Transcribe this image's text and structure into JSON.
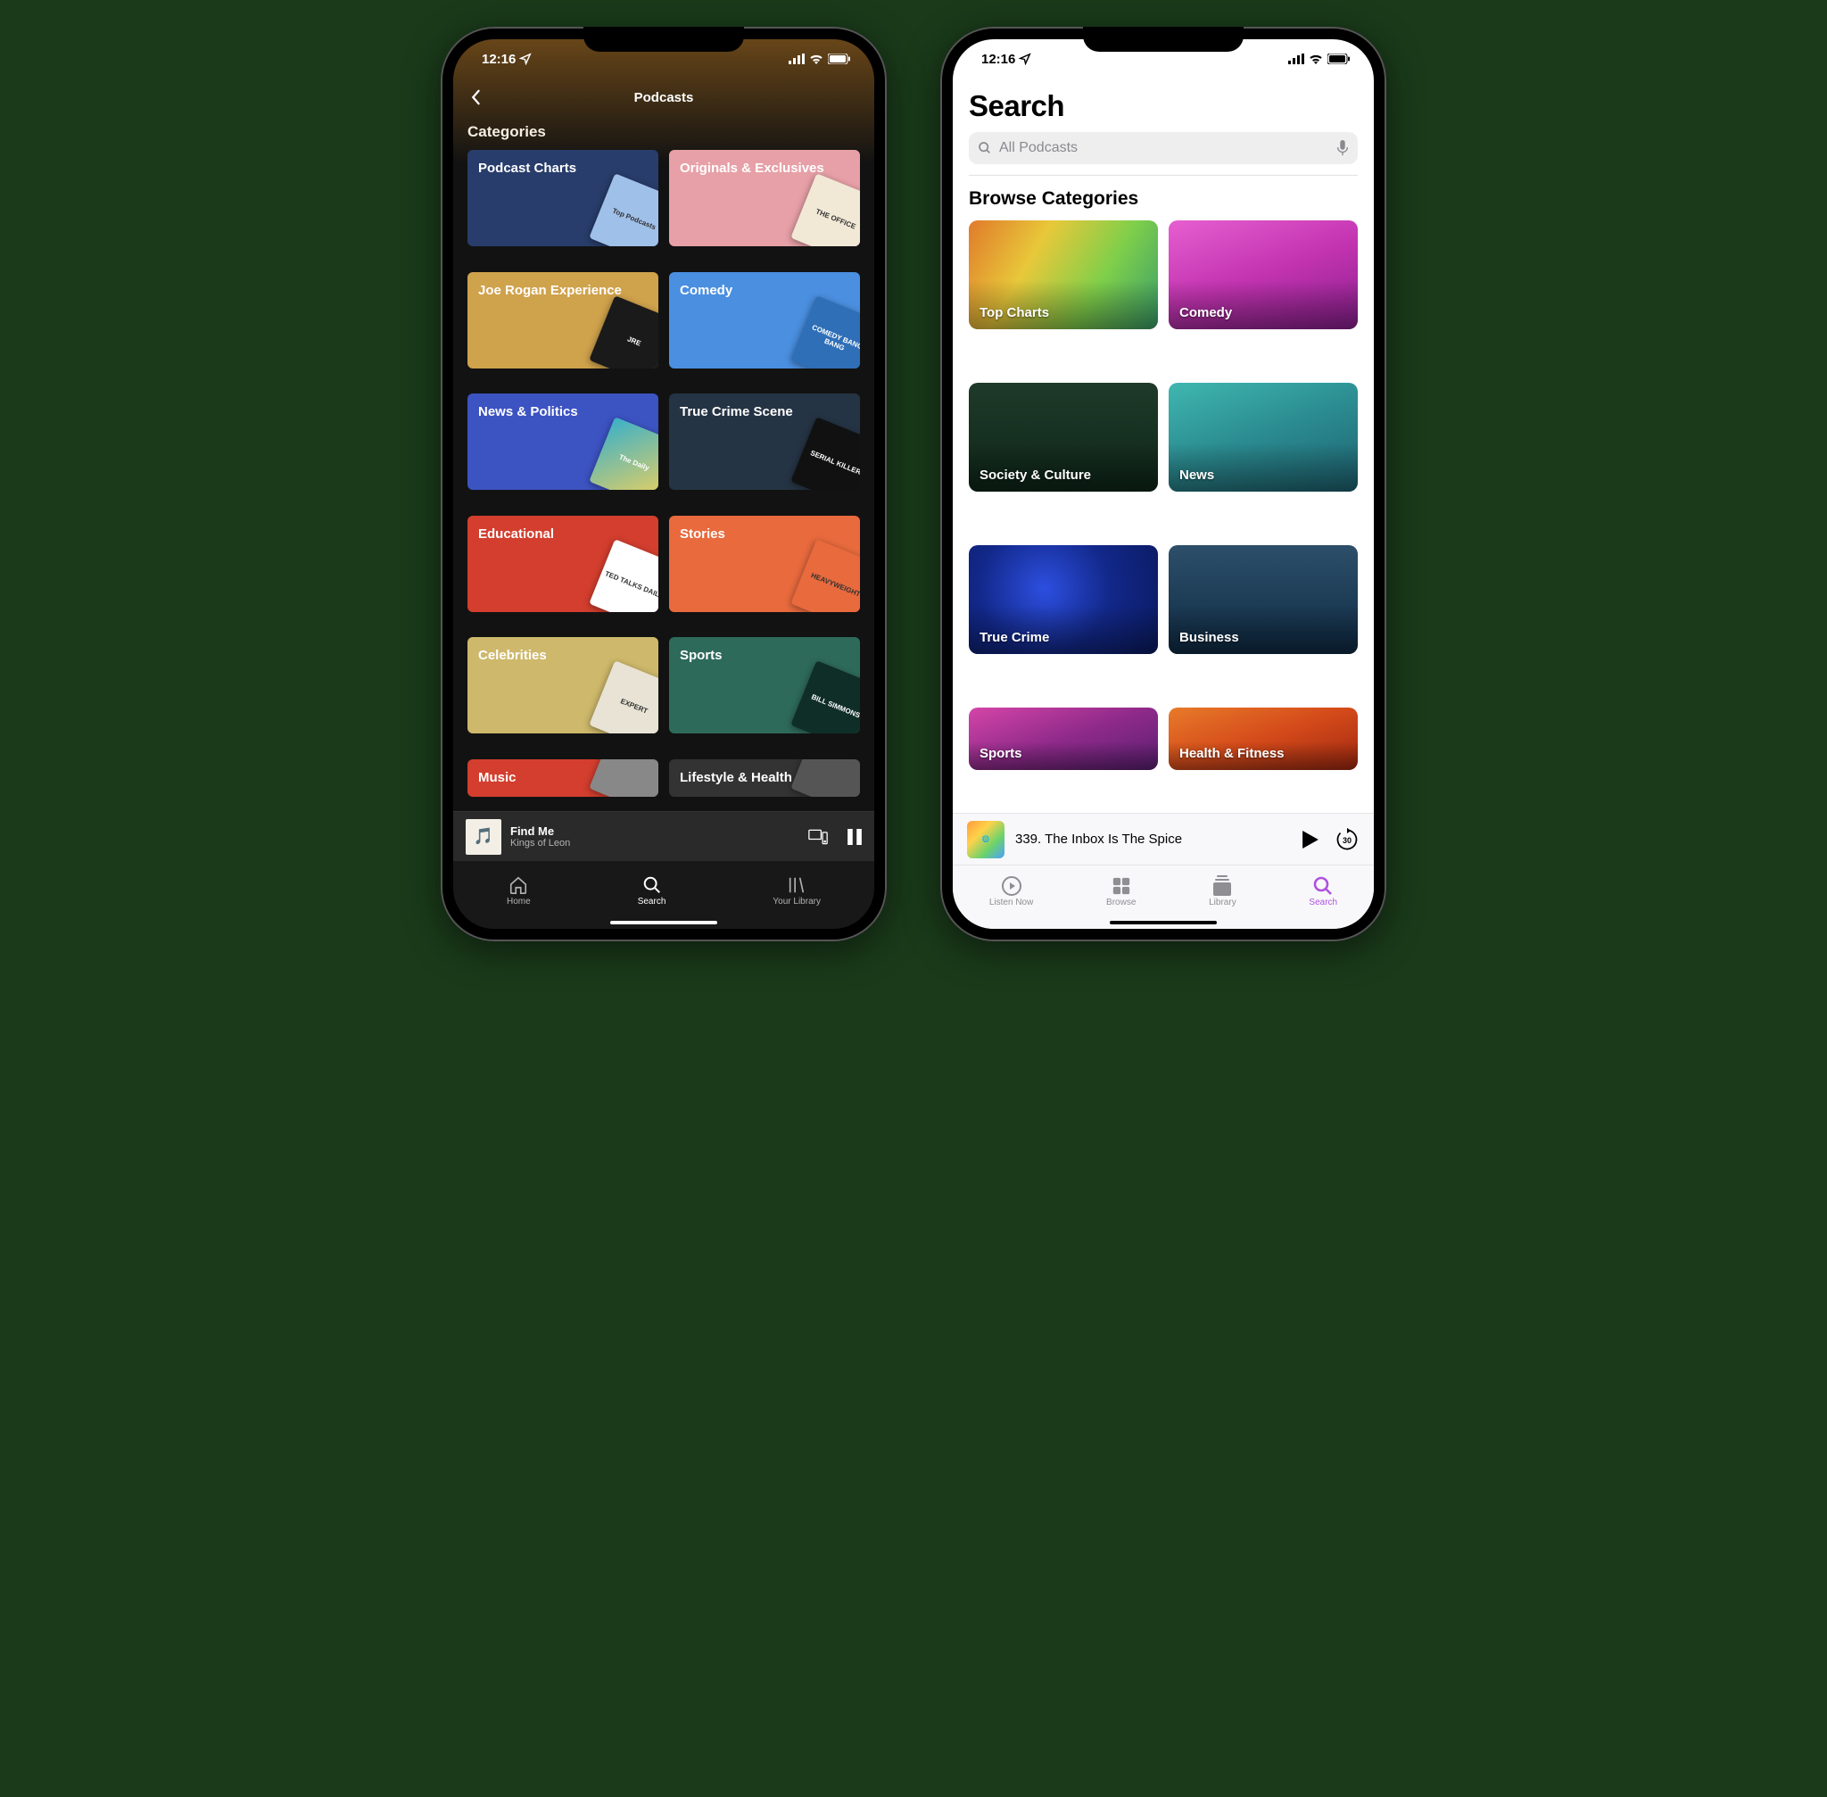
{
  "status": {
    "time": "12:16",
    "signal": "ıll",
    "wifi": "wifi",
    "battery": "full"
  },
  "spotify": {
    "nav_title": "Podcasts",
    "section_title": "Categories",
    "tiles": [
      {
        "label": "Podcast Charts",
        "bg": "#283d6b",
        "art": "#9fc0e9",
        "art_text": "Top Podcasts"
      },
      {
        "label": "Originals & Exclusives",
        "bg": "#e7a0a7",
        "art": "#f1e8d6",
        "art_text": "THE OFFICE"
      },
      {
        "label": "Joe Rogan Experience",
        "bg": "#cfa24c",
        "art": "#1a1a1a",
        "art_text": "JRE"
      },
      {
        "label": "Comedy",
        "bg": "#4a8fe0",
        "art": "#2f6fb8",
        "art_text": "COMEDY BANG BANG"
      },
      {
        "label": "News & Politics",
        "bg": "#3c53c2",
        "art": "linear-gradient(135deg,#3ab0c9,#f2d25a)",
        "art_text": "The Daily"
      },
      {
        "label": "True Crime Scene",
        "bg": "#253444",
        "art": "#111",
        "art_text": "SERIAL KILLER"
      },
      {
        "label": "Educational",
        "bg": "#d33e2e",
        "art": "#fff",
        "art_text": "TED TALKS DAILY"
      },
      {
        "label": "Stories",
        "bg": "#e86a3d",
        "art": "#e86a3d",
        "art_text": "HEAVYWEIGHT"
      },
      {
        "label": "Celebrities",
        "bg": "#ceb86b",
        "art": "#e8e3d5",
        "art_text": "EXPERT"
      },
      {
        "label": "Sports",
        "bg": "#2e6a5a",
        "art": "#0f2e27",
        "art_text": "BILL SIMMONS"
      },
      {
        "label": "Music",
        "bg": "#d33e2e",
        "art": "#888",
        "art_text": ""
      },
      {
        "label": "Lifestyle & Health",
        "bg": "#333",
        "art": "#555",
        "art_text": ""
      }
    ],
    "now_playing": {
      "title": "Find Me",
      "artist": "Kings of Leon"
    },
    "tabs": [
      {
        "label": "Home",
        "icon": "home"
      },
      {
        "label": "Search",
        "icon": "search",
        "active": true
      },
      {
        "label": "Your Library",
        "icon": "library"
      }
    ]
  },
  "apple": {
    "page_title": "Search",
    "search_placeholder": "All Podcasts",
    "section_title": "Browse Categories",
    "tiles": [
      {
        "label": "Top Charts",
        "bg": "linear-gradient(120deg,#e07a2a,#e8c83a,#7fcf4a,#3a9f6a)"
      },
      {
        "label": "Comedy",
        "bg": "linear-gradient(160deg,#e65fd0,#c233b0,#8a1f8f)"
      },
      {
        "label": "Society & Culture",
        "bg": "linear-gradient(180deg,#1f3a2a,#0e2618)"
      },
      {
        "label": "News",
        "bg": "linear-gradient(160deg,#3fb7b0,#2a8a8f,#1e6270)"
      },
      {
        "label": "True Crime",
        "bg": "radial-gradient(circle at 40% 40%,#2d4fe0,#12288a,#0a1a60)"
      },
      {
        "label": "Business",
        "bg": "linear-gradient(180deg,#2d4f6a,#0f2b44)"
      },
      {
        "label": "Sports",
        "bg": "linear-gradient(160deg,#d445a8,#8f2a8a,#5a1f72)"
      },
      {
        "label": "Health & Fitness",
        "bg": "linear-gradient(160deg,#e87a2a,#d44a1a,#a02810)"
      }
    ],
    "now_playing": {
      "title": "339. The Inbox Is The Spice",
      "art_label": "CONNECTED"
    },
    "skip_seconds": "30",
    "tabs": [
      {
        "label": "Listen Now",
        "icon": "play-circle"
      },
      {
        "label": "Browse",
        "icon": "grid"
      },
      {
        "label": "Library",
        "icon": "stack"
      },
      {
        "label": "Search",
        "icon": "search",
        "active": true
      }
    ]
  }
}
